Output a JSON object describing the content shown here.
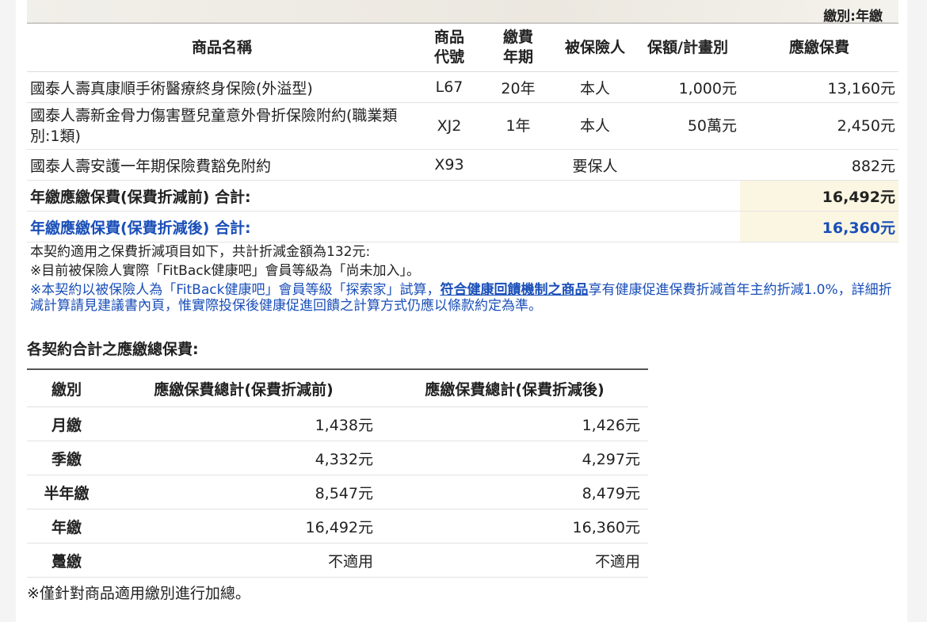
{
  "header": {
    "pay_type": "繳別:年繳"
  },
  "main_table": {
    "columns": [
      "商品名稱",
      "商品代號",
      "繳費年期",
      "被保險人",
      "保額/計畫別",
      "應繳保費"
    ],
    "col_lines": {
      "code": [
        "商品",
        "代號"
      ],
      "term": [
        "繳費",
        "年期"
      ]
    },
    "rows": [
      {
        "name": "國泰人壽真康順手術醫療終身保險(外溢型)",
        "code": "L67",
        "term": "20年",
        "insured": "本人",
        "amount": "1,000元",
        "premium": "13,160元"
      },
      {
        "name": "國泰人壽新金骨力傷害暨兒童意外骨折保險附約(職業類別:1類)",
        "code": "XJ2",
        "term": "1年",
        "insured": "本人",
        "amount": "50萬元",
        "premium": "2,450元"
      },
      {
        "name": "國泰人壽安護一年期保險費豁免附約",
        "code": "X93",
        "term": "",
        "insured": "要保人",
        "amount": "",
        "premium": "882元"
      }
    ],
    "total_before": {
      "label": "年繳應繳保費(保費折減前) 合計:",
      "value": "16,492元"
    },
    "total_after": {
      "label": "年繳應繳保費(保費折減後) 合計:",
      "value": "16,360元"
    }
  },
  "notes": {
    "line1": "本契約適用之保費折減項目如下，共計折減金額為132元:",
    "line2": "※目前被保險人實際「FitBack健康吧」會員等級為「尚未加入」。",
    "line3_prefix": "※本契約以被保險人為「FitBack健康吧」會員等級「探索家」試算，",
    "line3_link": "符合健康回饋機制之商品",
    "line3_suffix": "享有健康促進保費折減首年主約折減1.0%，詳細折減計算請見建議書內頁，惟實際投保後健康促進回饋之計算方式仍應以條款約定為準。"
  },
  "summary": {
    "title": "各契約合計之應繳總保費:",
    "columns": [
      "繳別",
      "應繳保費總計(保費折減前)",
      "應繳保費總計(保費折減後)"
    ],
    "rows": [
      {
        "label": "月繳",
        "before": "1,438元",
        "after": "1,426元"
      },
      {
        "label": "季繳",
        "before": "4,332元",
        "after": "4,297元"
      },
      {
        "label": "半年繳",
        "before": "8,547元",
        "after": "8,479元"
      },
      {
        "label": "年繳",
        "before": "16,492元",
        "after": "16,360元"
      },
      {
        "label": "躉繳",
        "before": "不適用",
        "after": "不適用"
      }
    ],
    "footnote": "※僅針對商品適用繳別進行加總。"
  },
  "colors": {
    "blue": "#1a4fb8",
    "highlight": "#fbf6e2"
  }
}
